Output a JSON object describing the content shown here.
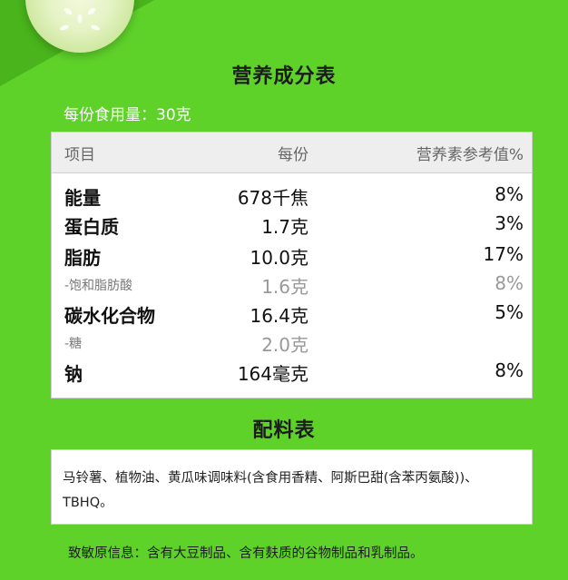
{
  "nutrition": {
    "title": "营养成分表",
    "serving": "每份食用量：30克",
    "headers": {
      "item": "项目",
      "per_serving": "每份",
      "nrv": "营养素参考值%"
    },
    "rows": [
      {
        "name": "能量",
        "amount": "678千焦",
        "nrv": "8%"
      },
      {
        "name": "蛋白质",
        "amount": "1.7克",
        "nrv": "3%"
      },
      {
        "name": "脂肪",
        "amount": "10.0克",
        "nrv": "17%"
      },
      {
        "name": "-饱和脂肪酸",
        "amount": "1.6克",
        "nrv": "8%"
      },
      {
        "name": "碳水化合物",
        "amount": "16.4克",
        "nrv": "5%"
      },
      {
        "name": "-糖",
        "amount": "2.0克",
        "nrv": ""
      },
      {
        "name": "钠",
        "amount": "164毫克",
        "nrv": "8%"
      }
    ]
  },
  "ingredients": {
    "title": "配料表",
    "text": "马铃薯、植物油、黄瓜味调味料(含食用香精、阿斯巴甜(含苯丙氨酸))、TBHQ。"
  },
  "allergen": "致敏原信息：含有大豆制品、含有麸质的谷物制品和乳制品。",
  "colors": {
    "background": "#5fd22a",
    "panel": "#ffffff",
    "header_row": "#eeeeee"
  },
  "decor": {
    "image": "cucumber-slice"
  }
}
